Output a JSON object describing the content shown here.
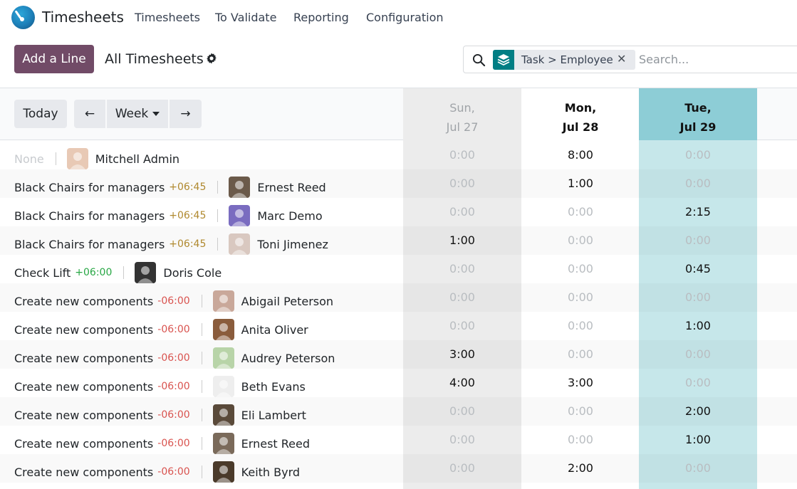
{
  "nav": {
    "app_title": "Timesheets",
    "menu": [
      "Timesheets",
      "To Validate",
      "Reporting",
      "Configuration"
    ]
  },
  "control": {
    "add_label": "Add a Line",
    "title": "All Timesheets",
    "facet": "Task > Employee",
    "search_placeholder": "Search..."
  },
  "toolbar": {
    "today": "Today",
    "prev": "←",
    "week": "Week",
    "next": "→"
  },
  "days": [
    {
      "name": "Sun,",
      "date": "Jul 27"
    },
    {
      "name": "Mon,",
      "date": "Jul 28"
    },
    {
      "name": "Tue,",
      "date": "Jul 29"
    }
  ],
  "rows": [
    {
      "task": "None",
      "delta": "",
      "employee": "Mitchell Admin",
      "sun": "0:00",
      "mon": "8:00",
      "tue": "0:00"
    },
    {
      "task": "Black Chairs for managers",
      "delta": "+06:45",
      "employee": "Ernest Reed",
      "sun": "0:00",
      "mon": "1:00",
      "tue": "0:00"
    },
    {
      "task": "Black Chairs for managers",
      "delta": "+06:45",
      "employee": "Marc Demo",
      "sun": "0:00",
      "mon": "0:00",
      "tue": "2:15"
    },
    {
      "task": "Black Chairs for managers",
      "delta": "+06:45",
      "employee": "Toni Jimenez",
      "sun": "1:00",
      "mon": "0:00",
      "tue": "0:00"
    },
    {
      "task": "Check Lift",
      "delta": "+06:00",
      "employee": "Doris Cole",
      "sun": "0:00",
      "mon": "0:00",
      "tue": "0:45"
    },
    {
      "task": "Create new components",
      "delta": "-06:00",
      "employee": "Abigail Peterson",
      "sun": "0:00",
      "mon": "0:00",
      "tue": "0:00"
    },
    {
      "task": "Create new components",
      "delta": "-06:00",
      "employee": "Anita Oliver",
      "sun": "0:00",
      "mon": "0:00",
      "tue": "1:00"
    },
    {
      "task": "Create new components",
      "delta": "-06:00",
      "employee": "Audrey Peterson",
      "sun": "3:00",
      "mon": "0:00",
      "tue": "0:00"
    },
    {
      "task": "Create new components",
      "delta": "-06:00",
      "employee": "Beth Evans",
      "sun": "4:00",
      "mon": "3:00",
      "tue": "0:00"
    },
    {
      "task": "Create new components",
      "delta": "-06:00",
      "employee": "Eli Lambert",
      "sun": "0:00",
      "mon": "0:00",
      "tue": "2:00"
    },
    {
      "task": "Create new components",
      "delta": "-06:00",
      "employee": "Ernest Reed",
      "sun": "0:00",
      "mon": "0:00",
      "tue": "1:00"
    },
    {
      "task": "Create new components",
      "delta": "-06:00",
      "employee": "Keith Byrd",
      "sun": "0:00",
      "mon": "2:00",
      "tue": "0:00"
    }
  ],
  "colors": {
    "brand": "#714b67",
    "today_column": "#8dcdd6",
    "positive": "#28a745",
    "warning": "#b0892f",
    "negative": "#d9534f"
  }
}
